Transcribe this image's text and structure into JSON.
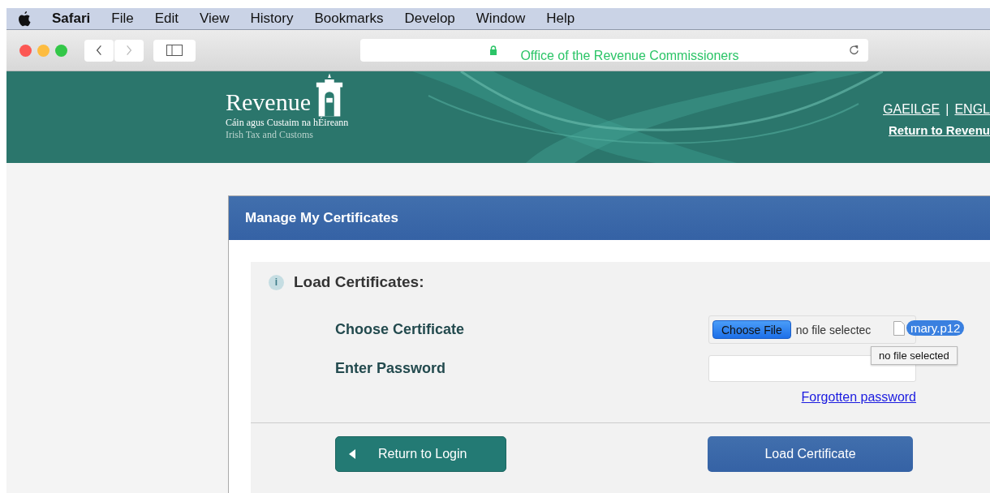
{
  "menu_bar": {
    "items": [
      {
        "label": "Safari",
        "kind": "app"
      },
      {
        "label": "File",
        "kind": "menu"
      },
      {
        "label": "Edit",
        "kind": "menu"
      },
      {
        "label": "View",
        "kind": "menu"
      },
      {
        "label": "History",
        "kind": "menu"
      },
      {
        "label": "Bookmarks",
        "kind": "menu"
      },
      {
        "label": "Develop",
        "kind": "menu"
      },
      {
        "label": "Window",
        "kind": "menu"
      },
      {
        "label": "Help",
        "kind": "menu"
      }
    ]
  },
  "toolbar": {
    "back_disabled": false,
    "forward_disabled": true,
    "address": "Office of the Revenue Commissioners",
    "secure": true
  },
  "header": {
    "logo": "Revenue",
    "subtitle_1": "Cáin agus Custaim na hÉireann",
    "subtitle_2": "Irish Tax and Customs",
    "languages": [
      "GAEILGE",
      "ENGL"
    ],
    "separator": "|",
    "return_link": "Return to Revenu"
  },
  "card": {
    "title": "Manage My Certificates",
    "info_glyph": "i",
    "section_title": "Load Certificates:",
    "fields": [
      {
        "label": "Choose Certificate",
        "kind": "file",
        "button": "Choose File",
        "value": "no file selectec"
      },
      {
        "label": "Enter Password",
        "kind": "password"
      }
    ],
    "forgot_link": "Forgotten password",
    "drag_file": "mary.p12",
    "tooltip": "no file selected",
    "buttons": [
      {
        "label": "Return to Login",
        "kind": "back"
      },
      {
        "label": "Load Certificate",
        "kind": "primary"
      }
    ]
  }
}
